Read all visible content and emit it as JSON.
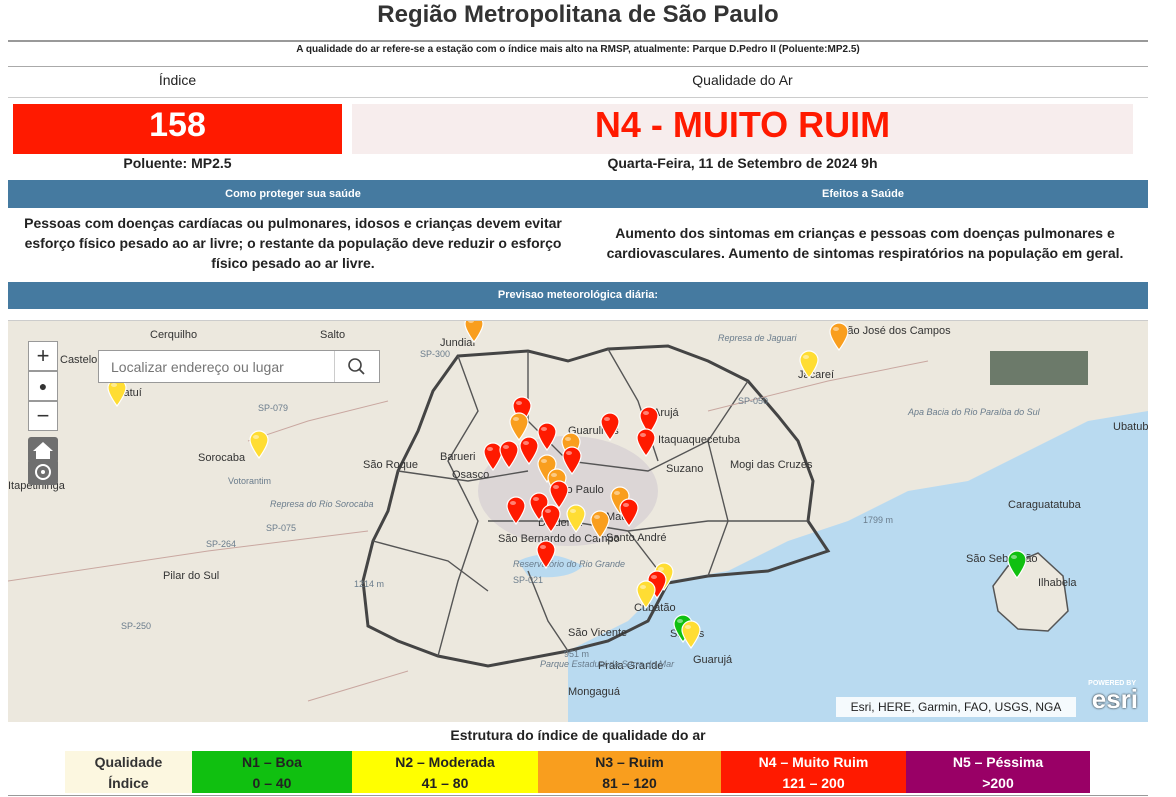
{
  "page": {
    "title": "Região Metropolitana de São Paulo",
    "subnote": "A qualidade do ar refere-se a estação com o índice mais alto na RMSP, atualmente: Parque D.Pedro II (Poluente:MP2.5)"
  },
  "summary": {
    "index_header": "Índice",
    "quality_header": "Qualidade do Ar",
    "index_value": "158",
    "quality_value": "N4 - MUITO RUIM",
    "pollutant": "Poluente: MP2.5",
    "date": "Quarta-Feira, 11 de Setembro de 2024  9h",
    "index_color": "#ff1a00"
  },
  "health": {
    "protect_header": "Como proteger sua saúde",
    "effects_header": "Efeitos a Saúde",
    "protect_text": "Pessoas com doenças cardíacas ou pulmonares, idosos e crianças devem evitar esforço físico pesado ao ar livre; o restante da população deve reduzir o esforço físico pesado ao ar livre.",
    "effects_text": "Aumento dos sintomas em crianças e pessoas com doenças pulmonares e cardiovasculares. Aumento de sintomas respiratórios na população em geral."
  },
  "forecast": {
    "header": "Previsao meteorológica diária:"
  },
  "map": {
    "zoom_in": "+",
    "zoom_out": "−",
    "search_placeholder": "Localizar endereço ou lugar",
    "attribution": "Esri, HERE, Garmin, FAO, USGS, NGA",
    "esri_powered": "POWERED BY",
    "esri_logo": "esri",
    "place_labels": [
      "Cerquilho",
      "Salto",
      "Jundiaí",
      "São José dos Campos",
      "Jacareí",
      "Castelo",
      "Tatuí",
      "Sorocaba",
      "Votorantim",
      "São Roque",
      "Barueri",
      "Osasco",
      "Guarulhos",
      "Arujá",
      "Itaquaquecetuba",
      "Suzano",
      "Mogi das Cruzes",
      "São Paulo",
      "Diadema",
      "Mauá",
      "Santo André",
      "São Bernardo do Campo",
      "Itapetininga",
      "Pilar do Sul",
      "Cubatão",
      "Santos",
      "São Vicente",
      "Praia Grande",
      "Guarujá",
      "Mongaguá",
      "São Sebastião",
      "Ilhabela",
      "Caraguatatuba",
      "Ubatuba",
      "Represa de Jaguari",
      "Represa do Rio Sorocaba",
      "Reservatório do Rio Grande",
      "Parque Estadual da Serra do Mar",
      "Apa Bacia do Rio Paraíba do Sul",
      "1214 m",
      "1799 m",
      "951 m",
      "SP-300",
      "SP-250",
      "SP-021",
      "SP-079",
      "SP-264",
      "SP-050",
      "SP-075"
    ]
  },
  "legend": {
    "title": "Estrutura do índice de qualidade do ar",
    "row_quality_label": "Qualidade",
    "row_index_label": "Índice",
    "levels": [
      {
        "name": "N1 – Boa",
        "range": "0 – 40",
        "color": "#10c010"
      },
      {
        "name": "N2 – Moderada",
        "range": "41 – 80",
        "color": "#ffff00"
      },
      {
        "name": "N3 – Ruim",
        "range": "81 – 120",
        "color": "#f99e1e"
      },
      {
        "name": "N4 – Muito Ruim",
        "range": "121 – 200",
        "color": "#ff1a00"
      },
      {
        "name": "N5 – Péssima",
        "range": ">200",
        "color": "#990066"
      }
    ]
  }
}
